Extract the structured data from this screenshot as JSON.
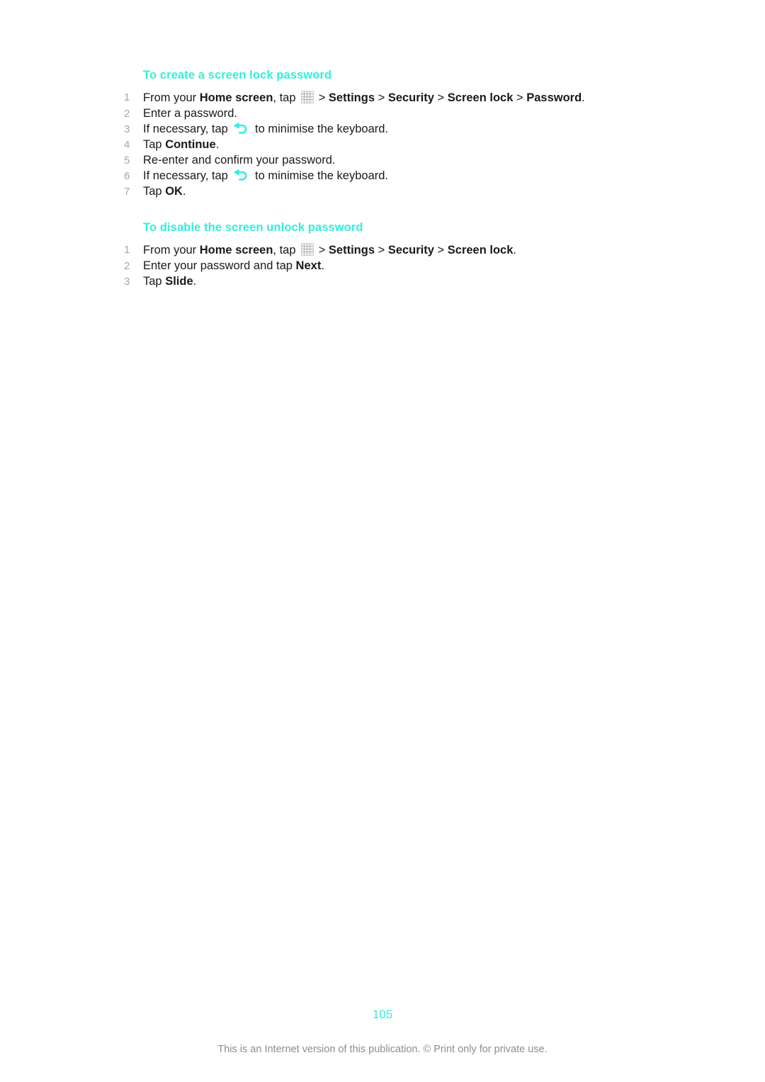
{
  "document": {
    "page_number": "105",
    "footer_note": "This is an Internet version of this publication. © Print only for private use.",
    "accent_color": "#2ff0da",
    "step_number_color": "#a6a6a6",
    "text_color": "#1a1a1a"
  },
  "sections": [
    {
      "heading": "To create a screen lock password",
      "steps": [
        {
          "number": "1",
          "parts": [
            {
              "type": "text",
              "value": "From your "
            },
            {
              "type": "bold",
              "value": "Home screen"
            },
            {
              "type": "text",
              "value": ", tap "
            },
            {
              "type": "icon",
              "value": "app-drawer-grid-icon"
            },
            {
              "type": "text",
              "value": " > "
            },
            {
              "type": "bold",
              "value": "Settings"
            },
            {
              "type": "text",
              "value": " > "
            },
            {
              "type": "bold",
              "value": "Security"
            },
            {
              "type": "text",
              "value": " > "
            },
            {
              "type": "bold",
              "value": "Screen lock"
            },
            {
              "type": "text",
              "value": " > "
            },
            {
              "type": "bold",
              "value": "Password"
            },
            {
              "type": "text",
              "value": "."
            }
          ]
        },
        {
          "number": "2",
          "parts": [
            {
              "type": "text",
              "value": "Enter a password."
            }
          ]
        },
        {
          "number": "3",
          "parts": [
            {
              "type": "text",
              "value": "If necessary, tap "
            },
            {
              "type": "icon",
              "value": "back-arrow-icon"
            },
            {
              "type": "text",
              "value": " to minimise the keyboard."
            }
          ]
        },
        {
          "number": "4",
          "parts": [
            {
              "type": "text",
              "value": "Tap "
            },
            {
              "type": "bold",
              "value": "Continue"
            },
            {
              "type": "text",
              "value": "."
            }
          ]
        },
        {
          "number": "5",
          "parts": [
            {
              "type": "text",
              "value": "Re-enter and confirm your password."
            }
          ]
        },
        {
          "number": "6",
          "parts": [
            {
              "type": "text",
              "value": "If necessary, tap "
            },
            {
              "type": "icon",
              "value": "back-arrow-icon"
            },
            {
              "type": "text",
              "value": " to minimise the keyboard."
            }
          ]
        },
        {
          "number": "7",
          "parts": [
            {
              "type": "text",
              "value": "Tap "
            },
            {
              "type": "bold",
              "value": "OK"
            },
            {
              "type": "text",
              "value": "."
            }
          ]
        }
      ]
    },
    {
      "heading": "To disable the screen unlock password",
      "steps": [
        {
          "number": "1",
          "parts": [
            {
              "type": "text",
              "value": "From your "
            },
            {
              "type": "bold",
              "value": "Home screen"
            },
            {
              "type": "text",
              "value": ", tap "
            },
            {
              "type": "icon",
              "value": "app-drawer-grid-icon"
            },
            {
              "type": "text",
              "value": " > "
            },
            {
              "type": "bold",
              "value": "Settings"
            },
            {
              "type": "text",
              "value": " > "
            },
            {
              "type": "bold",
              "value": "Security"
            },
            {
              "type": "text",
              "value": " > "
            },
            {
              "type": "bold",
              "value": "Screen lock"
            },
            {
              "type": "text",
              "value": "."
            }
          ]
        },
        {
          "number": "2",
          "parts": [
            {
              "type": "text",
              "value": "Enter your password and tap "
            },
            {
              "type": "bold",
              "value": "Next"
            },
            {
              "type": "text",
              "value": "."
            }
          ]
        },
        {
          "number": "3",
          "parts": [
            {
              "type": "text",
              "value": "Tap "
            },
            {
              "type": "bold",
              "value": "Slide"
            },
            {
              "type": "text",
              "value": "."
            }
          ]
        }
      ]
    }
  ]
}
